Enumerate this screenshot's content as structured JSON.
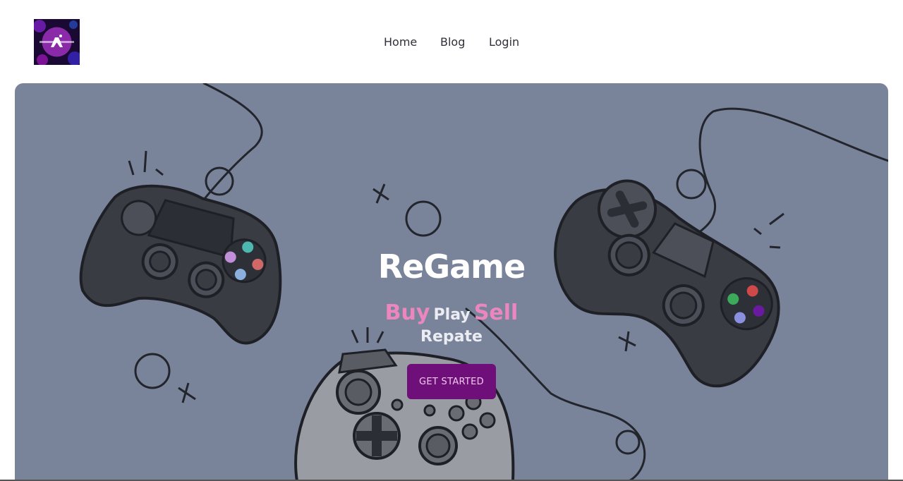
{
  "header": {
    "logo_alt": "ReGame logo",
    "nav": {
      "home": "Home",
      "blog": "Blog",
      "login": "Login"
    }
  },
  "hero": {
    "title": "ReGame",
    "tagline": {
      "buy": "Buy",
      "play": "Play",
      "sell": "Sell",
      "repeat": "Repate"
    },
    "cta_label": "GET STARTED"
  },
  "colors": {
    "hero_bg": "#79849b",
    "accent_pink": "#ec86bf",
    "cta_bg": "#6f0f7a",
    "cta_text": "#f2c9ef"
  }
}
